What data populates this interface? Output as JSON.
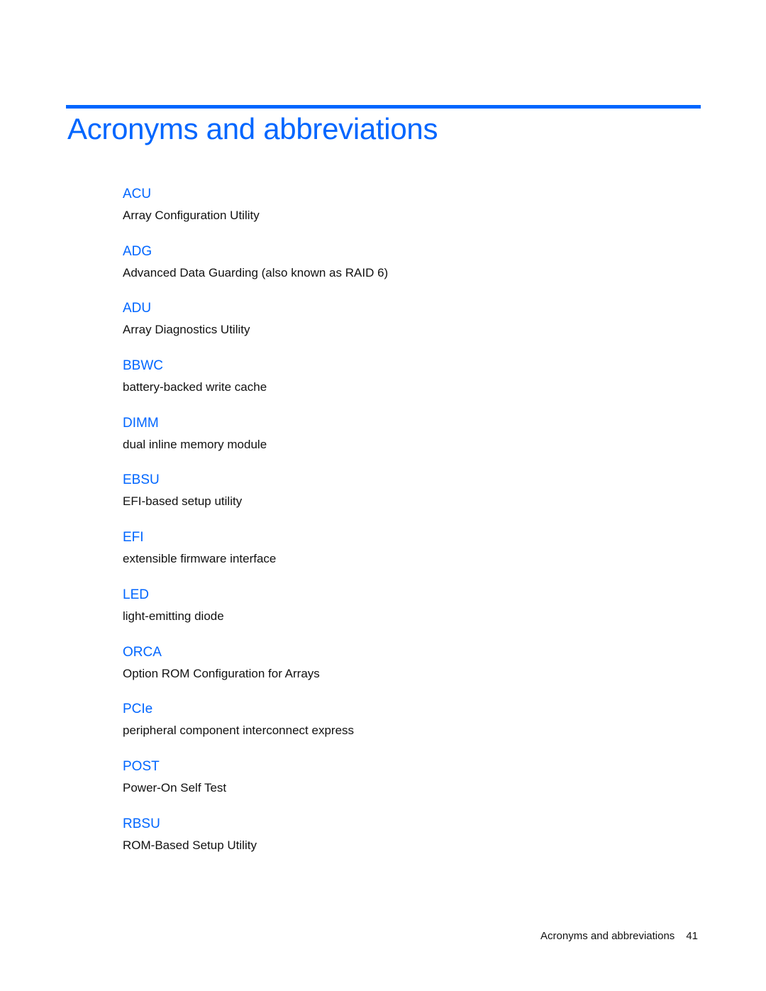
{
  "page": {
    "title": "Acronyms and abbreviations",
    "accent_color": "#0066ff",
    "entries": [
      {
        "term": "ACU",
        "definition": "Array Configuration Utility"
      },
      {
        "term": "ADG",
        "definition": "Advanced Data Guarding (also known as RAID 6)"
      },
      {
        "term": "ADU",
        "definition": "Array Diagnostics Utility"
      },
      {
        "term": "BBWC",
        "definition": "battery-backed write cache"
      },
      {
        "term": "DIMM",
        "definition": "dual inline memory module"
      },
      {
        "term": "EBSU",
        "definition": "EFI-based setup utility"
      },
      {
        "term": "EFI",
        "definition": "extensible firmware interface"
      },
      {
        "term": "LED",
        "definition": "light-emitting diode"
      },
      {
        "term": "ORCA",
        "definition": "Option ROM Configuration for Arrays"
      },
      {
        "term": "PCIe",
        "definition": "peripheral component interconnect express"
      },
      {
        "term": "POST",
        "definition": "Power-On Self Test"
      },
      {
        "term": "RBSU",
        "definition": "ROM-Based Setup Utility"
      }
    ],
    "footer": {
      "section": "Acronyms and abbreviations",
      "page_number": "41"
    }
  }
}
